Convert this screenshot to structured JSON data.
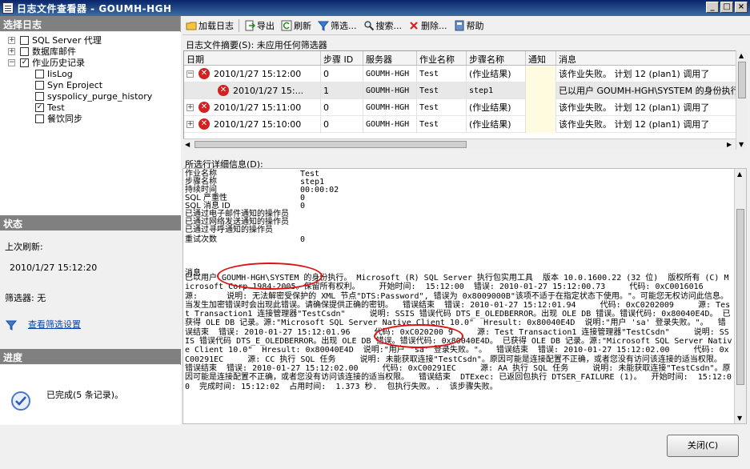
{
  "window": {
    "title": "日志文件查看器 - GOUMH-HGH"
  },
  "left": {
    "select_log_header": "选择日志",
    "tree": [
      {
        "label": "SQL Server 代理",
        "checked": false,
        "expander": "+"
      },
      {
        "label": "数据库邮件",
        "checked": false,
        "expander": "+"
      },
      {
        "label": "作业历史记录",
        "checked": true,
        "expander": "−"
      },
      {
        "label": "IisLog",
        "checked": false
      },
      {
        "label": "Syn Eproject",
        "checked": false
      },
      {
        "label": "syspolicy_purge_history",
        "checked": false
      },
      {
        "label": "Test",
        "checked": true
      },
      {
        "label": "餐饮同步",
        "checked": false
      }
    ],
    "status_header": "状态",
    "last_refresh_label": "上次刷新:",
    "last_refresh_value": "2010/1/27 15:12:20",
    "filter_label": "筛选器: 无",
    "view_filter_link": "查看筛选设置",
    "progress_header": "进度",
    "progress_text": "已完成(5 条记录)。"
  },
  "toolbar": {
    "load_log": "加载日志",
    "export": "导出",
    "refresh": "刷新",
    "filter": "筛选...",
    "search": "搜索...",
    "delete": "删除...",
    "help": "帮助"
  },
  "summary": "日志文件摘要(S): 未应用任何筛选器",
  "grid": {
    "columns": [
      "日期",
      "步骤 ID",
      "服务器",
      "作业名称",
      "步骤名称",
      "通知",
      "消息"
    ],
    "rows": [
      {
        "date": "2010/1/27 15:12:00",
        "step_id": "0",
        "server": "GOUMH-HGH",
        "job": "Test",
        "step": "(作业结果)",
        "notify": "",
        "message": "该作业失败。 计划 12 (plan1) 调用了",
        "expander": "−"
      },
      {
        "date": "2010/1/27 15:...",
        "step_id": "1",
        "server": "GOUMH-HGH",
        "job": "Test",
        "step": "step1",
        "notify": "",
        "message": "已以用户 GOUMH-HGH\\SYSTEM 的身份执行",
        "expander": ""
      },
      {
        "date": "2010/1/27 15:11:00",
        "step_id": "0",
        "server": "GOUMH-HGH",
        "job": "Test",
        "step": "(作业结果)",
        "notify": "",
        "message": "该作业失败。 计划 12 (plan1) 调用了",
        "expander": "+"
      },
      {
        "date": "2010/1/27 15:10:00",
        "step_id": "0",
        "server": "GOUMH-HGH",
        "job": "Test",
        "step": "(作业结果)",
        "notify": "",
        "message": "该作业失败。 计划 12 (plan1) 调用了",
        "expander": "+"
      }
    ]
  },
  "details": {
    "label": "所选行详细信息(D):",
    "fields": [
      {
        "key": "作业名称",
        "value": "Test"
      },
      {
        "key": "步骤名称",
        "value": "step1"
      },
      {
        "key": "持续时间",
        "value": "00:00:02"
      },
      {
        "key": "SQL 严重性",
        "value": "0"
      },
      {
        "key": "SQL 消息 ID",
        "value": "0"
      },
      {
        "key": "已通过电子邮件通知的操作员",
        "value": ""
      },
      {
        "key": "已通过网络发送通知的操作员",
        "value": ""
      },
      {
        "key": "已通过寻呼通知的操作员",
        "value": ""
      },
      {
        "key": "重试次数",
        "value": "0"
      }
    ],
    "message_label": "消息",
    "message_text": "已以用户 GOUMH-HGH\\SYSTEM 的身份执行。 Microsoft (R) SQL Server 执行包实用工具  版本 10.0.1600.22 (32 位)  版权所有 (C) Microsoft Corp 1984-2005。保留所有权利。    开始时间:  15:12:00  错误: 2010-01-27 15:12:00.73     代码: 0xC0016016     源:      说明: 无法解密受保护的 XML 节点\"DTS:Password\", 错误为 0x8009000B\"该项不适于在指定状态下使用。\"。可能您无权访问此信息。当发生加密错误时会出现此错误。请确保提供正确的密钥。  错误结束  错误: 2010-01-27 15:12:01.94     代码: 0xC0202009     源: Test Transaction1 连接管理器\"TestCsdn\"     说明: SSIS 错误代码 DTS_E_OLEDBERROR。出现 OLE DB 错误。错误代码: 0x80040E4D。 已获得 OLE DB 记录。源:\"Microsoft SQL Server Native Client 10.0\"  Hresult: 0x80040E4D  说明:\"用户 'sa' 登录失败。\"。  错误结束  错误: 2010-01-27 15:12:01.96     代码: 0xC020200 9     源: Test Transaction1 连接管理器\"TestCsdn\"     说明: SSIS 错误代码 DTS_E_OLEDBERROR。出现 OLE DB 错误。错误代码: 0x80040E4D。 已获得 OLE DB 记录。源:\"Microsoft SQL Server Native Client 10.0\"  Hresult: 0x80040E4D  说明:\"用户 'sa' 登录失败。\"。  错误结束  错误: 2010-01-27 15:12:02.00     代码: 0xC00291EC     源: CC 执行 SQL 任务     说明: 未能获取连接\"TestCsdn\"。原因可能是连接配置不正确，或者您没有访问该连接的适当权限。  错误结束  错误: 2010-01-27 15:12:02.00     代码: 0xC00291EC     源: AA 执行 SQL 任务     说明: 未能获取连接\"TestCsdn\"。原因可能是连接配置不正确，或者您没有访问该连接的适当权限。  错误结束  DTExec: 已返回包执行 DTSER_FAILURE (1)。  开始时间:  15:12:00  完成时间: 15:12:02  占用时间:  1.373 秒.  包执行失败。.  该步骤失败。"
  },
  "close_button": "关闭(C)",
  "colors": {
    "error": "#d42020",
    "annotation": "#e01010",
    "link": "#0645ad"
  }
}
